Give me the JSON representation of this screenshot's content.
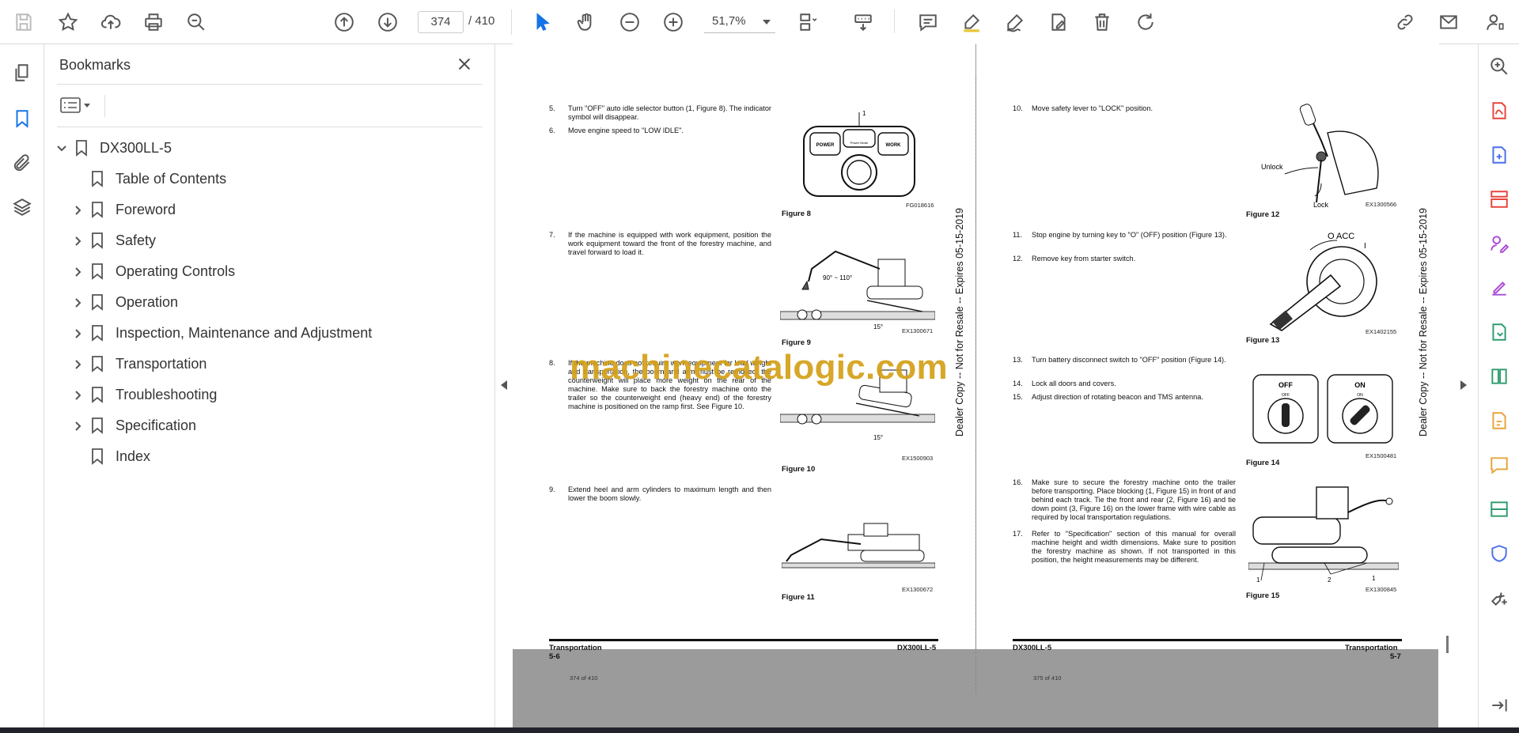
{
  "toolbar": {
    "current_page": "374",
    "total_pages": "/ 410",
    "zoom": "51,7%"
  },
  "bookmarks": {
    "title": "Bookmarks",
    "root": "DX300LL-5",
    "items": [
      {
        "label": "Table of Contents",
        "expandable": false
      },
      {
        "label": "Foreword",
        "expandable": true
      },
      {
        "label": "Safety",
        "expandable": true
      },
      {
        "label": "Operating Controls",
        "expandable": true
      },
      {
        "label": "Operation",
        "expandable": true
      },
      {
        "label": "Inspection, Maintenance and Adjustment",
        "expandable": true
      },
      {
        "label": "Transportation",
        "expandable": true
      },
      {
        "label": "Troubleshooting",
        "expandable": true
      },
      {
        "label": "Specification",
        "expandable": true
      },
      {
        "label": "Index",
        "expandable": false
      }
    ]
  },
  "doc": {
    "watermark": "machinecatalogic.com",
    "left": {
      "steps": [
        {
          "num": "5.",
          "text": "Turn \"OFF\" auto idle selector button (1, Figure 8). The indicator symbol will disappear."
        },
        {
          "num": "6.",
          "text": "Move engine speed to \"LOW IDLE\"."
        },
        {
          "num": "7.",
          "text": "If the machine is equipped with work equipment, position the work equipment toward the front of the forestry machine, and travel forward to load it."
        },
        {
          "num": "8.",
          "text": "If the machine does not require work equipment for load weight and transportation, the boom and arm must be removed, the counterweight will place more weight on the rear of the machine. Make sure to back the forestry machine onto the trailer so the counterweight end (heavy end) of the forestry machine is positioned on the ramp first. See Figure 10."
        },
        {
          "num": "9.",
          "text": "Extend heel and arm cylinders to maximum length and then lower the boom slowly."
        }
      ],
      "figures": [
        {
          "caption": "Figure 8",
          "code": "FG018616"
        },
        {
          "caption": "Figure 9",
          "code": "EX1300671"
        },
        {
          "caption": "Figure 10",
          "code": "EX1500903"
        },
        {
          "caption": "Figure 11",
          "code": "EX1300672"
        }
      ],
      "fig_labels": {
        "callout_1": "1",
        "power": "POWER",
        "work": "WORK",
        "mode_caption": "Power Mode",
        "angle": "90° ~ 110°",
        "ramp_angle_a": "15°",
        "ramp_angle_b": "15°"
      },
      "footer_section": "Transportation",
      "footer_page": "5-6",
      "footer_model": "DX300LL-5",
      "page_of": "374 of 410",
      "vertical": "Dealer Copy -- Not for Resale -- Expires 05-15-2019"
    },
    "right": {
      "steps": [
        {
          "num": "10.",
          "text": "Move safety lever to \"LOCK\" position."
        },
        {
          "num": "11.",
          "text": "Stop engine by turning key to \"O\" (OFF) position (Figure 13)."
        },
        {
          "num": "12.",
          "text": "Remove key from starter switch."
        },
        {
          "num": "13.",
          "text": "Turn battery disconnect switch to \"OFF\" position (Figure 14)."
        },
        {
          "num": "14.",
          "text": "Lock all doors and covers."
        },
        {
          "num": "15.",
          "text": "Adjust direction of rotating beacon and TMS antenna."
        },
        {
          "num": "16.",
          "text": "Make sure to secure the forestry machine onto the trailer before transporting. Place blocking (1, Figure 15) in front of and behind each track. Tie the front and rear (2, Figure 16) and tie down point (3, Figure 16) on the lower frame with wire cable as required by local transportation regulations."
        },
        {
          "num": "17.",
          "text": "Refer to \"Specification\" section of this manual for overall machine height and width dimensions. Make sure to position the forestry machine as shown. If not transported in this position, the height measurements may be different."
        }
      ],
      "figures": [
        {
          "caption": "Figure 12",
          "code": "EX1300566"
        },
        {
          "caption": "Figure 13",
          "code": "EX1402155"
        },
        {
          "caption": "Figure 14",
          "code": "EX1500481"
        },
        {
          "caption": "Figure 15",
          "code": "EX1300845"
        }
      ],
      "fig_labels": {
        "unlock": "Unlock",
        "lock": "Lock",
        "key_positions": "O  ACC",
        "key_on": "I",
        "off": "OFF",
        "on": "ON",
        "off_small": "OFF",
        "on_small": "ON",
        "callout_1a": "1",
        "callout_2": "2",
        "callout_1b": "1"
      },
      "footer_section": "Transportation",
      "footer_page": "5-7",
      "footer_model": "DX300LL-5",
      "page_of": "375 of 410",
      "vertical": "Dealer Copy -- Not for Resale -- Expires 05-15-2019"
    }
  }
}
